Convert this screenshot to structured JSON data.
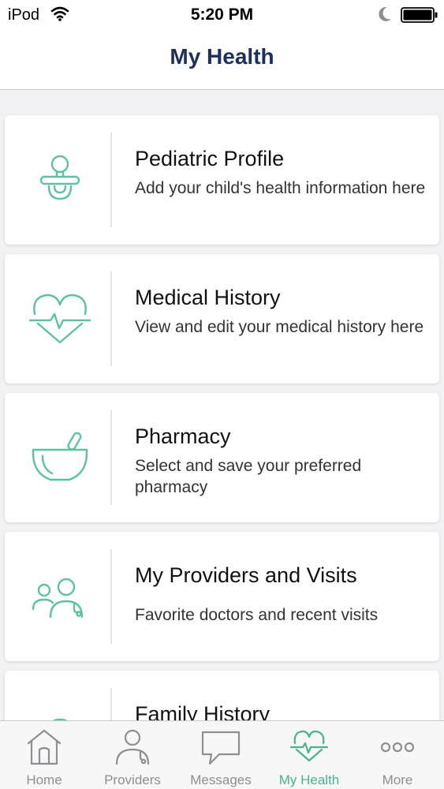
{
  "status_bar": {
    "carrier": "iPod",
    "time": "5:20 PM"
  },
  "header": {
    "title": "My Health"
  },
  "colors": {
    "accent": "#5cc2a0",
    "title": "#1d2f5b",
    "tab_inactive": "#8e8e93"
  },
  "cards": [
    {
      "icon": "pacifier-icon",
      "title": "Pediatric Profile",
      "description": "Add your child's health information here"
    },
    {
      "icon": "heart-pulse-icon",
      "title": "Medical History",
      "description": "View and edit your medical history here"
    },
    {
      "icon": "mortar-pestle-icon",
      "title": "Pharmacy",
      "description": "Select and save your preferred pharmacy"
    },
    {
      "icon": "providers-icon",
      "title": "My Providers and Visits",
      "description": "Favorite doctors and recent visits"
    },
    {
      "icon": "family-tree-icon",
      "title": "Family History",
      "description": ""
    }
  ],
  "tab_bar": {
    "tabs": [
      {
        "icon": "home-icon",
        "label": "Home",
        "active": false
      },
      {
        "icon": "providers-icon",
        "label": "Providers",
        "active": false
      },
      {
        "icon": "messages-icon",
        "label": "Messages",
        "active": false
      },
      {
        "icon": "heart-pulse-icon",
        "label": "My Health",
        "active": true
      },
      {
        "icon": "more-icon",
        "label": "More",
        "active": false
      }
    ]
  }
}
